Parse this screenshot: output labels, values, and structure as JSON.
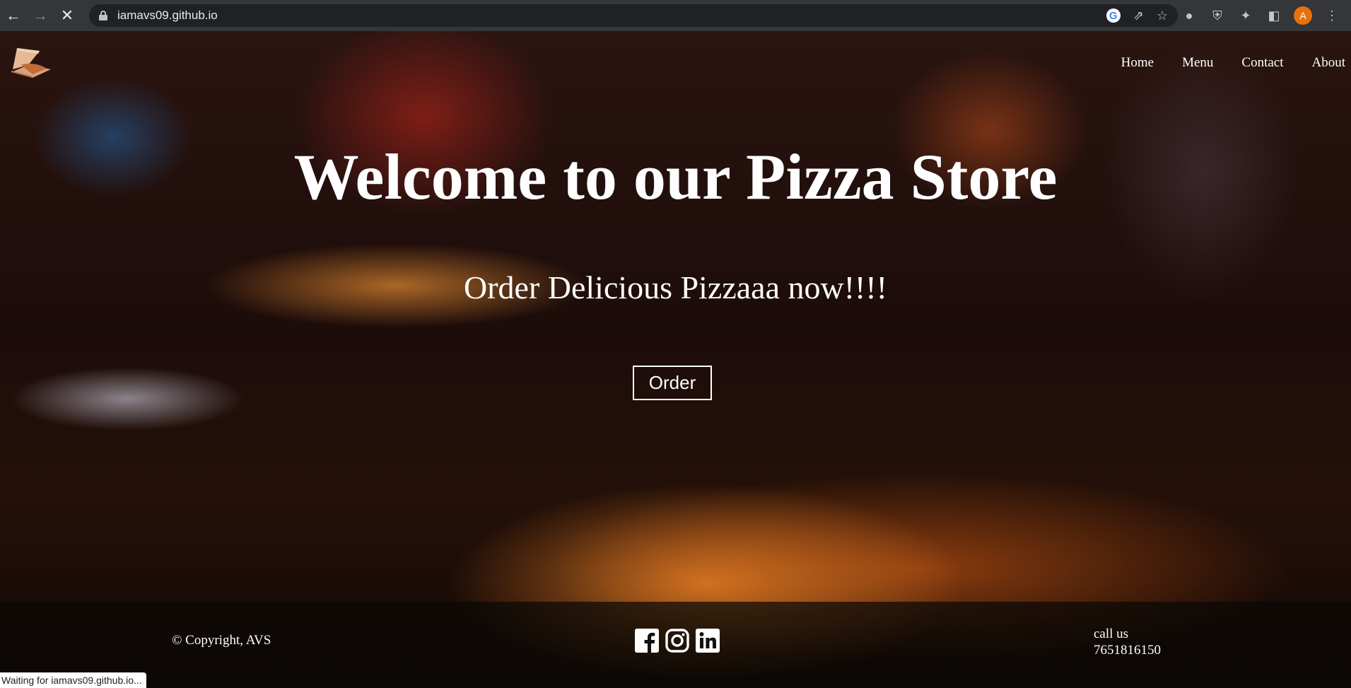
{
  "browser": {
    "url": "iamavs09.github.io",
    "profile_initial": "A",
    "status_text": "Waiting for iamavs09.github.io..."
  },
  "nav": {
    "items": [
      "Home",
      "Menu",
      "Contact",
      "About"
    ]
  },
  "hero": {
    "title": "Welcome to our Pizza Store",
    "subtitle": "Order Delicious Pizzaaa now!!!!",
    "order_button": "Order"
  },
  "footer": {
    "copyright": "© Copyright, AVS",
    "call_label": "call us",
    "phone": "7651816150",
    "social_icons": [
      "facebook-icon",
      "instagram-icon",
      "linkedin-icon"
    ]
  },
  "colors": {
    "chrome_bg": "#35363a",
    "omnibox_bg": "#202124",
    "profile_accent": "#e8710a",
    "text": "#ffffff"
  }
}
